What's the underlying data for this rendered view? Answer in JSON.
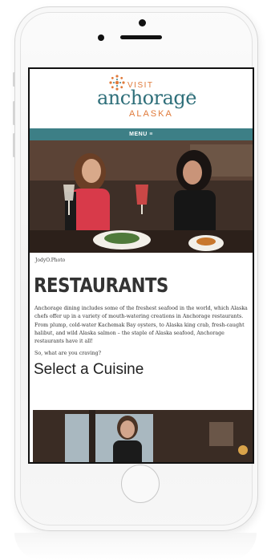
{
  "site": {
    "logo_visit": "VISIT",
    "logo_main": "anchorage",
    "logo_reg": "®",
    "logo_alaska": "ALASKA",
    "menu_label": "MENU ≡"
  },
  "hero": {
    "photo_credit": "JodyO.Photo"
  },
  "content": {
    "title": "RESTAURANTS",
    "intro": "Anchorage dining includes some of the freshest seafood in the world, which Alaska chefs offer up in a variety of mouth-watering creations in Anchorage restaurants. From plump, cold-water Kachemak Bay oysters, to Alaska king crab, fresh-caught halibut, and wild Alaska salmon – the staple of Alaska seafood, Anchorage restaurants have it all!",
    "question": "So, what are you craving?",
    "section_title": "Select a Cuisine"
  },
  "colors": {
    "brand_teal": "#3d7f86",
    "brand_orange": "#e07a3a",
    "logo_teal": "#2f6f7a"
  },
  "icons": [
    "camera-icon",
    "speaker-grill",
    "home-button",
    "logo-burst-icon",
    "menu-hamburger-icon"
  ]
}
